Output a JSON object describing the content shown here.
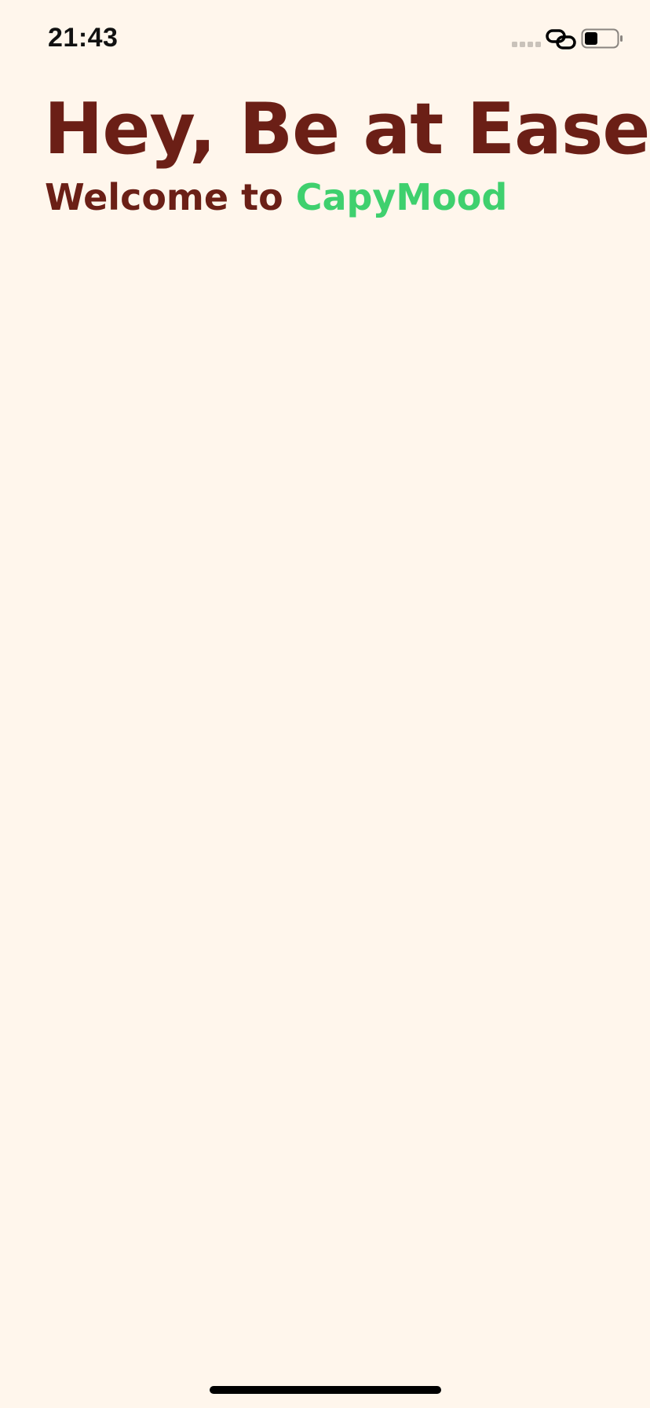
{
  "status_bar": {
    "time": "21:43",
    "icons": [
      "signal-dots-icon",
      "link-icon",
      "battery-icon"
    ],
    "battery_level": 0.4
  },
  "welcome": {
    "headline": "Hey, Be at Ease!",
    "subtitle_prefix": "Welcome to ",
    "app_name": "CapyMood"
  },
  "colors": {
    "background": "#FFF6EC",
    "headline": "#6B1F16",
    "brand": "#3FD06E",
    "status_text": "#111111"
  }
}
